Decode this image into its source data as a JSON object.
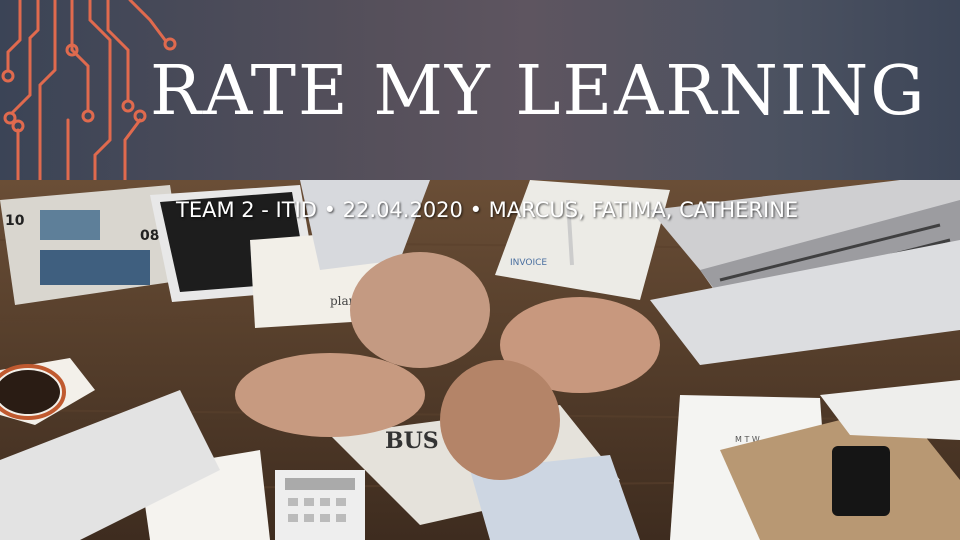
{
  "slide": {
    "title": "RATE MY LEARNING",
    "subtitle": "TEAM 2 - ITID • 22.04.2020 • MARCUS, FATIMA, CATHERINE"
  },
  "icons": {
    "circuit": "circuit-board-icon"
  },
  "photo_labels": {
    "plan_text": "plan",
    "business_text": "BUS",
    "invoice_text": "INVOICE",
    "calendar_text": "M T W"
  },
  "colors": {
    "banner_left": "#3b4456",
    "banner_mid": "#5e5560",
    "circuit": "#e06a4e",
    "title": "#ffffff"
  }
}
